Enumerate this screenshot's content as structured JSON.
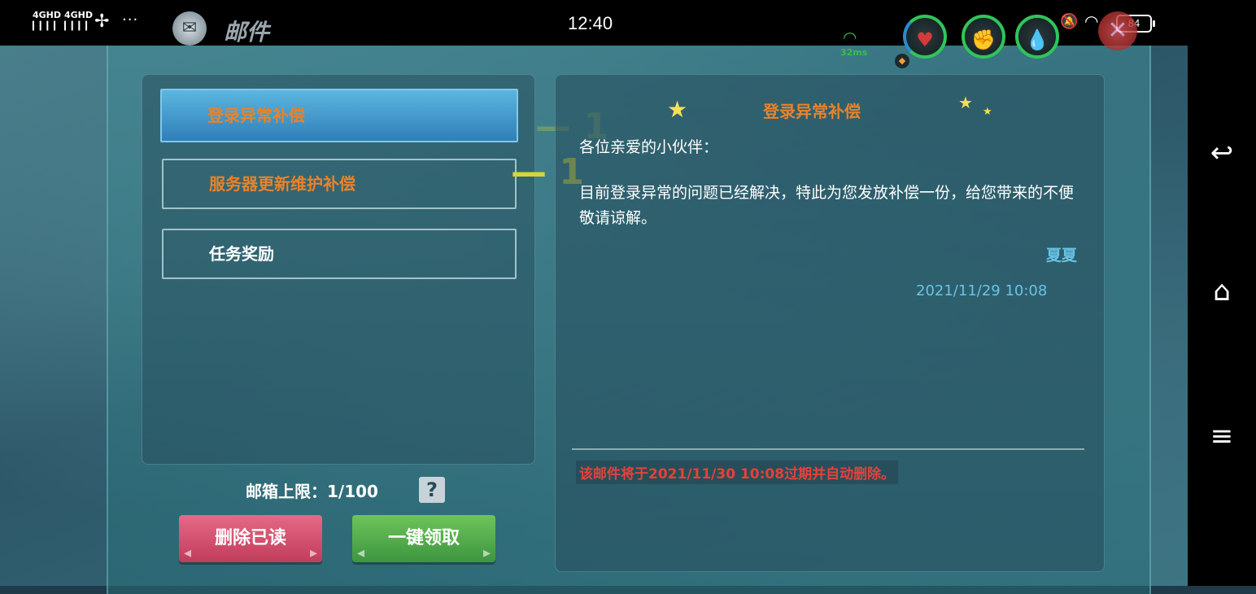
{
  "status_bar": {
    "sim1": "4GHD",
    "sim2": "4GHD",
    "signal_bars": "▎▎▎▎",
    "fan_icon": "fan-icon",
    "more": "···",
    "time": "12:40",
    "battery": "84",
    "mute_icon": "bell-muted-icon",
    "wifi_icon": "wifi-icon"
  },
  "header": {
    "title": "邮件",
    "ping": "32ms",
    "stats": {
      "hp_icon": "heart-icon",
      "stamina_icon": "arm-icon",
      "mana_icon": "droplet-icon"
    },
    "close_glyph": "✕"
  },
  "mail_list": {
    "items": [
      {
        "label": "登录异常补偿",
        "state": "selected"
      },
      {
        "label": "服务器更新维护补偿",
        "state": "unread"
      },
      {
        "label": "任务奖励",
        "state": "read"
      }
    ],
    "marker_glyph": "— 1"
  },
  "footer": {
    "limit_label": "邮箱上限：",
    "limit_value": "1/100",
    "help": "?",
    "delete_read": "删除已读",
    "claim_all": "一键领取"
  },
  "mail_detail": {
    "subject": "登录异常补偿",
    "greeting": "各位亲爱的小伙伴：",
    "body": "目前登录异常的问题已经解决，特此为您发放补偿一份，给您带来的不便敬请谅解。",
    "sender": "夏夏",
    "date": "2021/11/29 10:08",
    "expiry": "该邮件将于2021/11/30 10:08过期并自动删除。"
  },
  "colors": {
    "accent_orange": "#e8832b",
    "info_blue": "#68c3e6",
    "warning_red": "#e6413a",
    "delete_pink": "#d1506f",
    "claim_green": "#52a84a"
  },
  "nav": {
    "back_icon": "back-icon",
    "home_icon": "home-icon",
    "menu_icon": "menu-icon"
  }
}
